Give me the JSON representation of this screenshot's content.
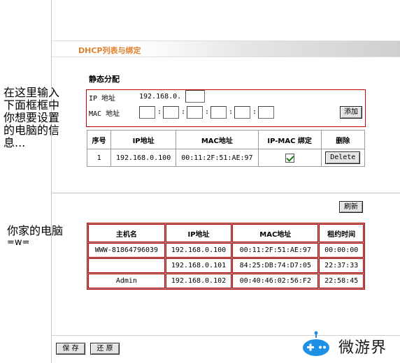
{
  "page": {
    "title": "DHCP列表与绑定"
  },
  "static": {
    "section_title": "静态分配",
    "ip_label": "IP 地址",
    "ip_prefix": "192.168.0.",
    "mac_label": "MAC 地址",
    "add_button": "添加"
  },
  "binding_table": {
    "headers": [
      "序号",
      "IP地址",
      "MAC地址",
      "IP-MAC 绑定",
      "删除"
    ],
    "rows": [
      {
        "index": "1",
        "ip": "192.168.0.100",
        "mac": "00:11:2F:51:AE:97",
        "bound": true,
        "delete_label": "Delete"
      }
    ]
  },
  "refresh_button": "刷新",
  "client_table": {
    "headers": [
      "主机名",
      "IP地址",
      "MAC地址",
      "租约时间"
    ],
    "rows": [
      {
        "host": "WWW-81864796039",
        "ip": "192.168.0.100",
        "mac": "00:11:2F:51:AE:97",
        "lease": "00:00:00"
      },
      {
        "host": "",
        "ip": "192.168.0.101",
        "mac": "84:25:DB:74:D7:05",
        "lease": "22:37:33"
      },
      {
        "host": "Admin",
        "ip": "192.168.0.102",
        "mac": "00:40:46:02:56:F2",
        "lease": "22:58:45"
      }
    ]
  },
  "footer": {
    "save_button": "保 存",
    "restore_button": "还 原"
  },
  "annotations": {
    "left_note": [
      "在这里输入",
      "下面框框中",
      "你想要设置",
      "的电脑的信",
      "息..."
    ],
    "pc_note": [
      "你家的电脑",
      "=w="
    ]
  },
  "watermark": {
    "text": "微游界"
  },
  "colors": {
    "title_orange": "#e0802a",
    "highlight_red": "#c00000",
    "logo_blue": "#1e90e6"
  }
}
